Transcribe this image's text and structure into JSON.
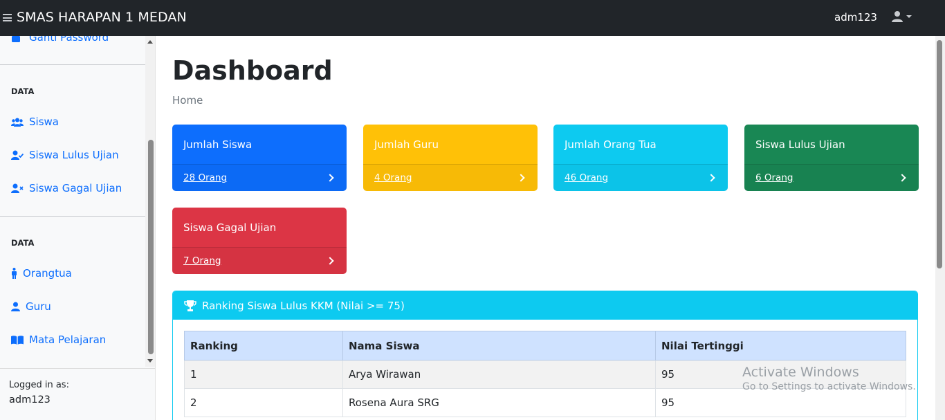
{
  "app": {
    "brand": "SMAS HARAPAN 1 MEDAN",
    "user": "adm123"
  },
  "sidebar": {
    "top_item": "Ganti Password",
    "section1_heading": "DATA",
    "section1_items": [
      "Siswa",
      "Siswa Lulus Ujian",
      "Siswa Gagal Ujian"
    ],
    "section2_heading": "DATA",
    "section2_items": [
      "Orangtua",
      "Guru",
      "Mata Pelajaran"
    ],
    "footer_label": "Logged in as:",
    "footer_user": "adm123"
  },
  "page": {
    "title": "Dashboard",
    "breadcrumb": "Home"
  },
  "cards": [
    {
      "title": "Jumlah Siswa",
      "link": "28 Orang",
      "color": "#0d6efd"
    },
    {
      "title": "Jumlah Guru",
      "link": "4 Orang",
      "color": "#ffc107"
    },
    {
      "title": "Jumlah Orang Tua",
      "link": "46 Orang",
      "color": "#0dcaf0"
    },
    {
      "title": "Siswa Lulus Ujian",
      "link": "6 Orang",
      "color": "#198754"
    },
    {
      "title": "Siswa Gagal Ujian",
      "link": "7 Orang",
      "color": "#dc3545"
    }
  ],
  "ranking": {
    "title": "Ranking Siswa Lulus KKM (Nilai >= 75)",
    "columns": [
      "Ranking",
      "Nama Siswa",
      "Nilai Tertinggi"
    ],
    "rows": [
      [
        "1",
        "Arya Wirawan",
        "95"
      ],
      [
        "2",
        "Rosena Aura SRG",
        "95"
      ]
    ]
  },
  "watermark": {
    "line1": "Activate Windows",
    "line2": "Go to Settings to activate Windows."
  }
}
